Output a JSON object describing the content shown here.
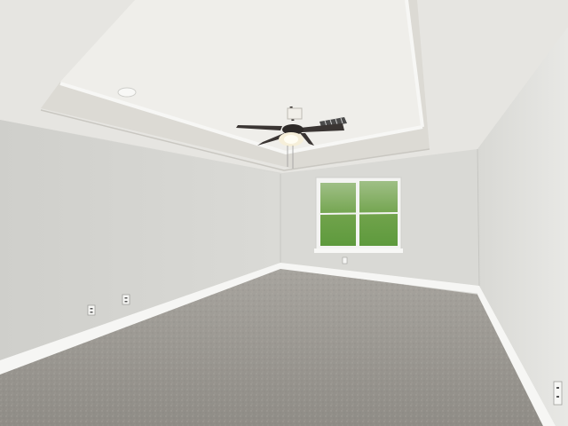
{
  "scene": {
    "colors": {
      "ceiling": "#e9e8e4",
      "tray_ceiling": "#efeeea",
      "tray_side": "#dcdad4",
      "left_wall": "#d6d6d2",
      "back_wall": "#d9d9d5",
      "right_wall": "#e2e2df",
      "baseboard": "#f6f6f4",
      "carpet": "#9b9892",
      "window_frame": "#f4f4f2",
      "window_glass": "#7fae5a",
      "fan_blade": "#3a3533"
    },
    "icons": [
      "ceiling-fan-icon",
      "smoke-detector-icon",
      "air-vent-icon",
      "outlet-icon"
    ]
  }
}
